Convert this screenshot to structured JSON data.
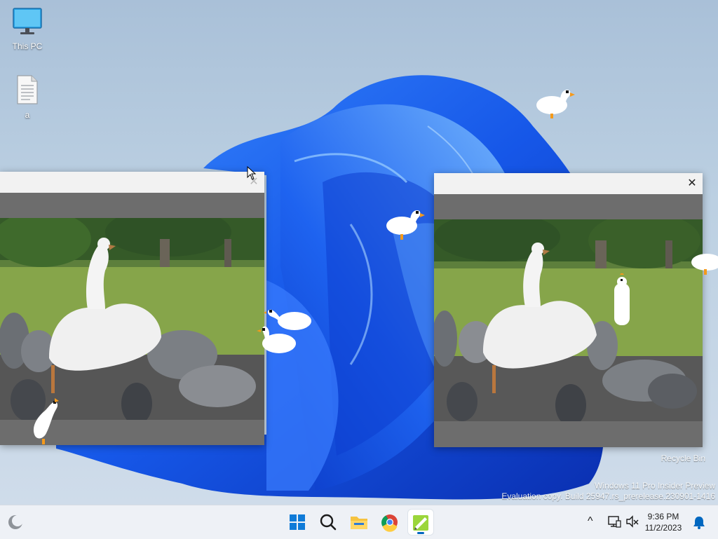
{
  "desktop": {
    "icons": [
      {
        "label": "This PC",
        "icon": "monitor-icon"
      },
      {
        "label": "a",
        "icon": "text-file-icon"
      }
    ],
    "recycle_bin": {
      "label": "Recycle Bin",
      "icon": "recycle-bin-icon"
    },
    "watermark": {
      "line1": "Windows 11 Pro Insider Preview",
      "line2": "Evaluation copy. Build 25947.rs_prerelease.230901-1416"
    }
  },
  "windows": [
    {
      "close_glyph": "✕",
      "content": "goose video frame"
    },
    {
      "close_glyph": "✕",
      "content": "goose video frame"
    }
  ],
  "taskbar": {
    "apps": [
      {
        "name": "start",
        "icon": "windows-start-icon"
      },
      {
        "name": "search",
        "icon": "search-icon"
      },
      {
        "name": "file-explorer",
        "icon": "folder-icon"
      },
      {
        "name": "chrome",
        "icon": "chrome-icon"
      },
      {
        "name": "goose-app",
        "icon": "notepad-icon",
        "active": true
      }
    ],
    "tray": {
      "chevron": "^",
      "time": "9:36 PM",
      "date": "11/2/2023"
    }
  },
  "colors": {
    "accent": "#0067c0",
    "wallpaper_blue": "#1c5cf0",
    "video_gray": "#6d6d6d"
  }
}
